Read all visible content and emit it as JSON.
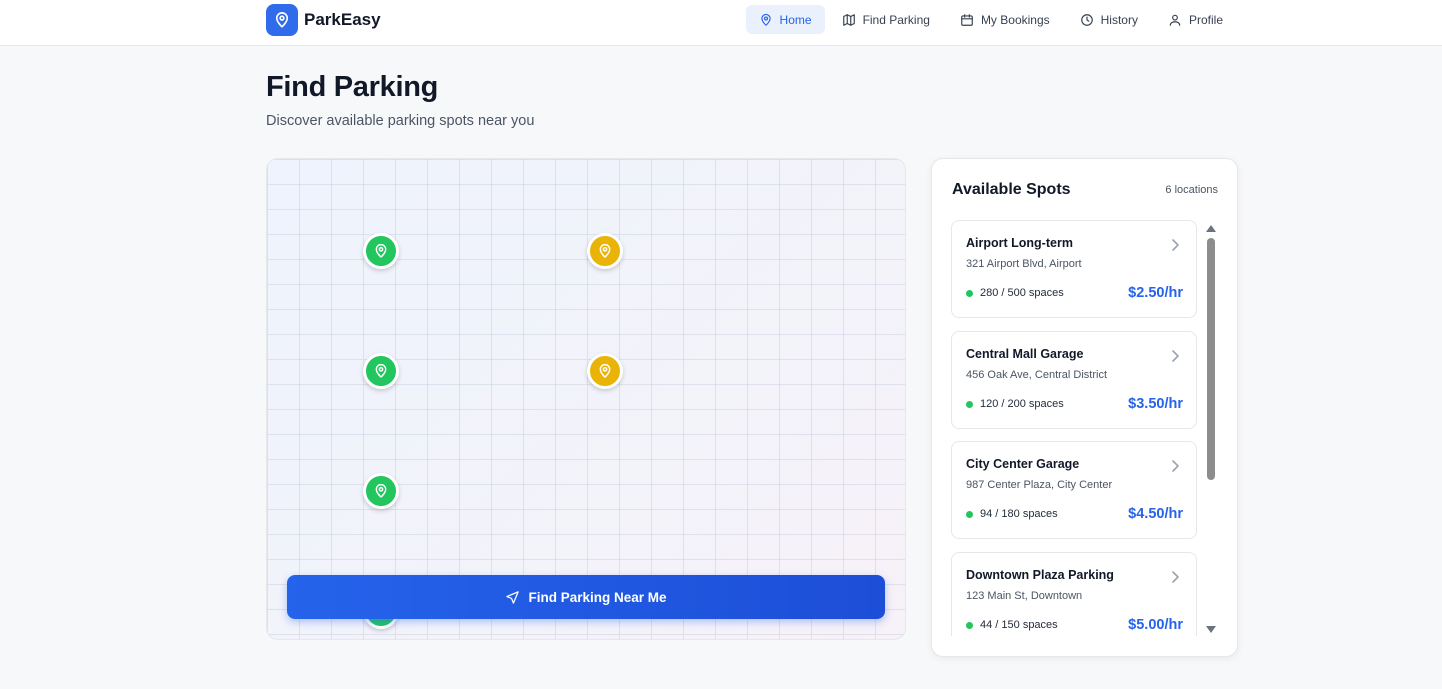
{
  "app": {
    "name": "ParkEasy"
  },
  "nav": [
    {
      "label": "Home",
      "icon": "map-pin-icon",
      "active": true
    },
    {
      "label": "Find Parking",
      "icon": "map-icon",
      "active": false
    },
    {
      "label": "My Bookings",
      "icon": "calendar-icon",
      "active": false
    },
    {
      "label": "History",
      "icon": "clock-icon",
      "active": false
    },
    {
      "label": "Profile",
      "icon": "user-icon",
      "active": false
    }
  ],
  "header": {
    "title": "Find Parking",
    "subtitle": "Discover available parking spots near you"
  },
  "map": {
    "markers": [
      {
        "status": "green"
      },
      {
        "status": "yellow"
      },
      {
        "status": "green"
      },
      {
        "status": "yellow"
      },
      {
        "status": "green"
      },
      {
        "status": "green"
      }
    ],
    "find_button_label": "Find Parking Near Me"
  },
  "panel": {
    "title": "Available Spots",
    "count": "6 locations",
    "spots": [
      {
        "name": "Airport Long-term",
        "address": "321 Airport Blvd, Airport",
        "spaces": "280 / 500 spaces",
        "price": "$2.50/hr"
      },
      {
        "name": "Central Mall Garage",
        "address": "456 Oak Ave, Central District",
        "spaces": "120 / 200 spaces",
        "price": "$3.50/hr"
      },
      {
        "name": "City Center Garage",
        "address": "987 Center Plaza, City Center",
        "spaces": "94 / 180 spaces",
        "price": "$4.50/hr"
      },
      {
        "name": "Downtown Plaza Parking",
        "address": "123 Main St, Downtown",
        "spaces": "44 / 150 spaces",
        "price": "$5.00/hr"
      }
    ]
  },
  "colors": {
    "accent": "#2563eb",
    "available": "#22c55e",
    "limited": "#eab308"
  }
}
